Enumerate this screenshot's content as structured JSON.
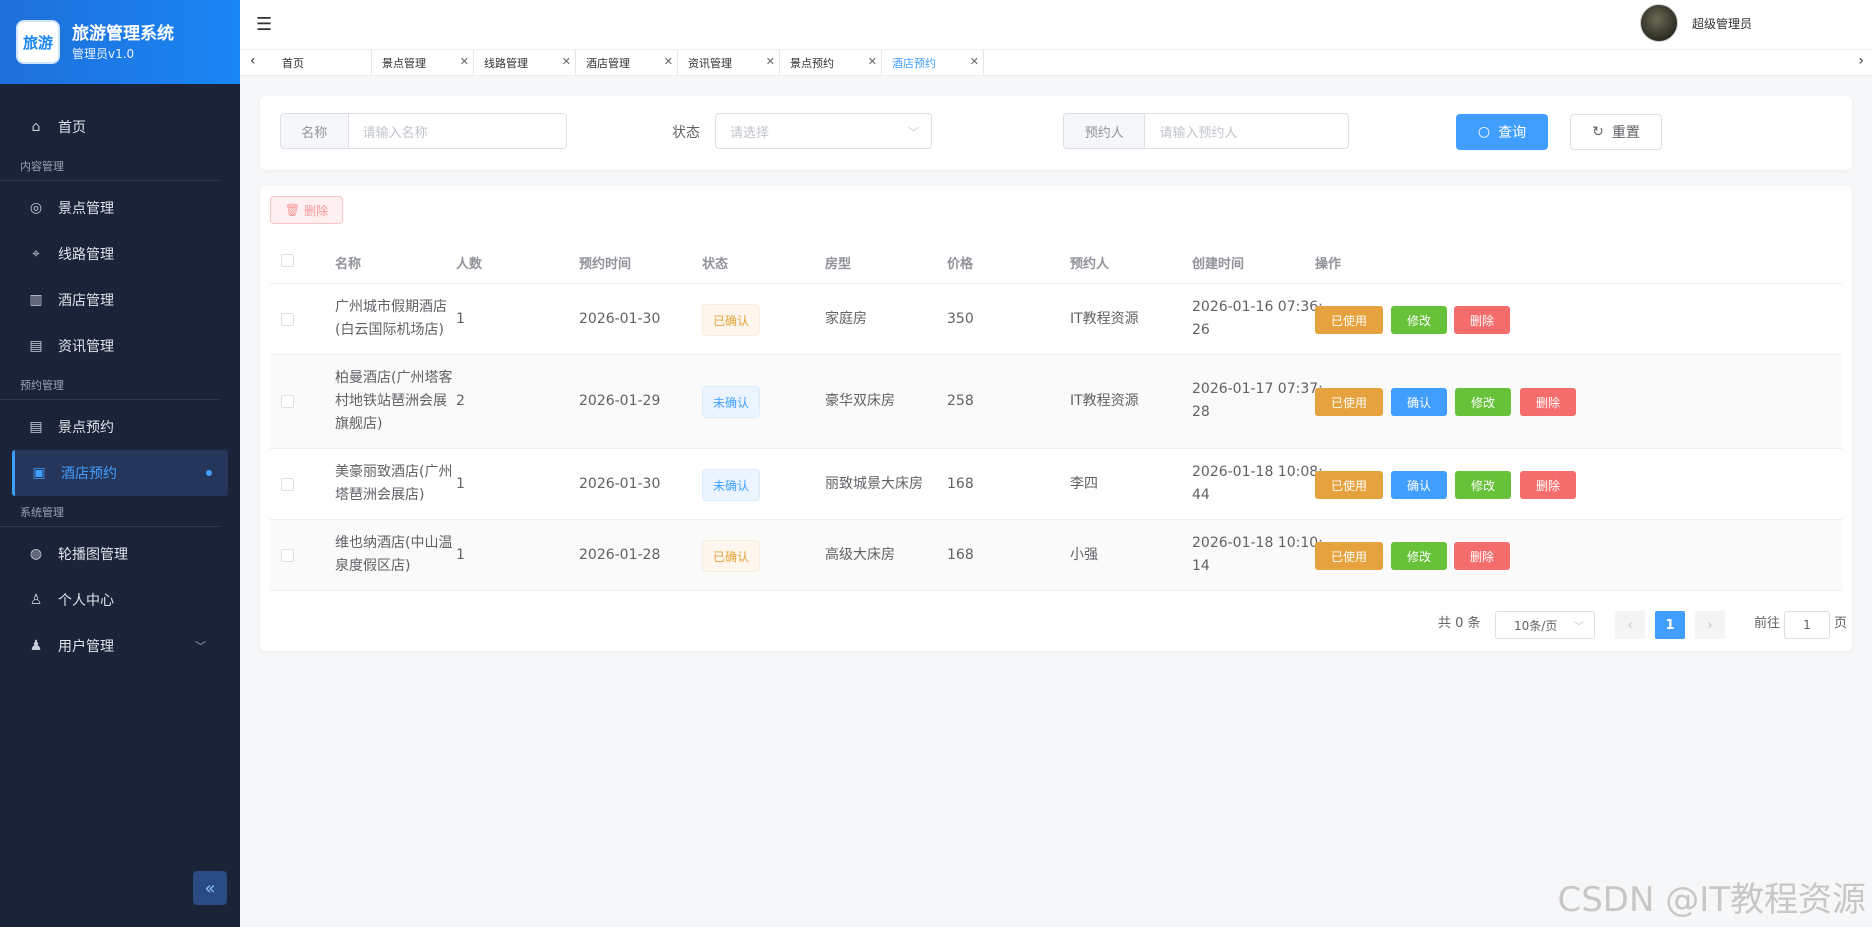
{
  "brand": {
    "logo_text": "旅游",
    "title": "旅游管理系统",
    "subtitle": "管理员v1.0"
  },
  "sidebar": {
    "home": "首页",
    "group_content": "内容管理",
    "scenic": "景点管理",
    "route": "线路管理",
    "hotel": "酒店管理",
    "news": "资讯管理",
    "group_booking": "预约管理",
    "scenic_booking": "景点预约",
    "hotel_booking": "酒店预约",
    "group_system": "系统管理",
    "carousel": "轮播图管理",
    "profile": "个人中心",
    "users": "用户管理"
  },
  "topbar": {
    "username": "超级管理员"
  },
  "tabs": [
    {
      "label": "首页"
    },
    {
      "label": "景点管理"
    },
    {
      "label": "线路管理"
    },
    {
      "label": "酒店管理"
    },
    {
      "label": "资讯管理"
    },
    {
      "label": "景点预约"
    },
    {
      "label": "酒店预约"
    }
  ],
  "search": {
    "name_label": "名称",
    "name_placeholder": "请输入名称",
    "status_label": "状态",
    "status_placeholder": "请选择",
    "booker_label": "预约人",
    "booker_placeholder": "请输入预约人",
    "query": "查询",
    "reset": "重置"
  },
  "table": {
    "delete_button": "删除",
    "headers": {
      "name": "名称",
      "people": "人数",
      "date": "预约时间",
      "status": "状态",
      "room": "房型",
      "price": "价格",
      "booker": "预约人",
      "created": "创建时间",
      "actions": "操作"
    },
    "actions": {
      "used": "已使用",
      "confirm": "确认",
      "edit": "修改",
      "delete": "删除"
    },
    "rows": [
      {
        "name_l1": "广州城市假期酒店",
        "name_l2": "(白云国际机场店)",
        "name_l3": "",
        "people": "1",
        "date": "2026-01-30",
        "status": "已确认",
        "room": "家庭房",
        "price": "350",
        "booker": "IT教程资源",
        "created_l1": "2026-01-16 07:36:",
        "created_l2": "26"
      },
      {
        "name_l1": "柏曼酒店(广州塔客",
        "name_l2": "村地铁站琶洲会展",
        "name_l3": "旗舰店)",
        "people": "2",
        "date": "2026-01-29",
        "status": "未确认",
        "room": "豪华双床房",
        "price": "258",
        "booker": "IT教程资源",
        "created_l1": "2026-01-17 07:37:",
        "created_l2": "28"
      },
      {
        "name_l1": "美豪丽致酒店(广州",
        "name_l2": "塔琶洲会展店)",
        "name_l3": "",
        "people": "1",
        "date": "2026-01-30",
        "status": "未确认",
        "room": "丽致城景大床房",
        "price": "168",
        "booker": "李四",
        "created_l1": "2026-01-18 10:08:",
        "created_l2": "44"
      },
      {
        "name_l1": "维也纳酒店(中山温",
        "name_l2": "泉度假区店)",
        "name_l3": "",
        "people": "1",
        "date": "2026-01-28",
        "status": "已确认",
        "room": "高级大床房",
        "price": "168",
        "booker": "小强",
        "created_l1": "2026-01-18 10:10:",
        "created_l2": "14"
      }
    ]
  },
  "pager": {
    "total": "共 0 条",
    "size": "10条/页",
    "prev": "‹",
    "current": "1",
    "next": "›",
    "goto": "前往",
    "goto_value": "1",
    "goto_unit": "页"
  },
  "watermark": "CSDN @IT教程资源"
}
